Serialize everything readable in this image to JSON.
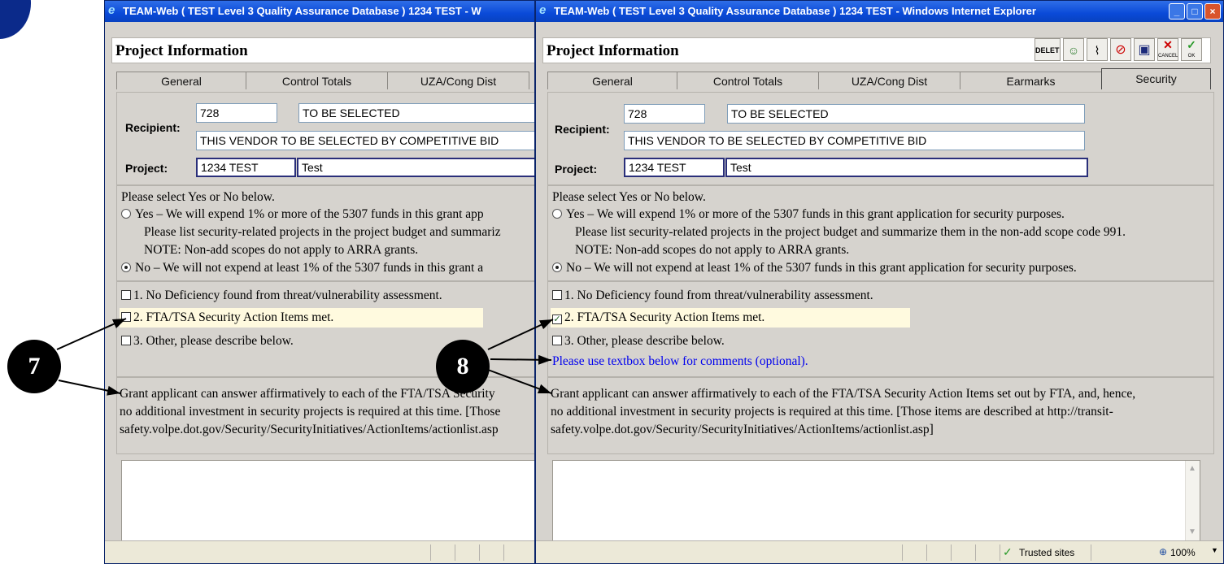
{
  "left_window": {
    "title": "TEAM-Web ( TEST Level 3 Quality Assurance Database ) 1234 TEST - W",
    "header_title": "Project Information",
    "tabs": [
      "General",
      "Control Totals",
      "UZA/Cong Dist"
    ],
    "recipient_label": "Recipient:",
    "recipient_id": "728",
    "recipient_short": "TO BE SELECTED",
    "recipient_full": "THIS VENDOR TO BE SELECTED BY COMPETITIVE BID",
    "project_label": "Project:",
    "project_id": "1234 TEST",
    "project_name": "Test",
    "prompt": "Please select Yes or No below.",
    "yes_option": "Yes – We will expend 1% or more of the 5307 funds in this grant app",
    "yes_note1": "Please list security-related projects in the project budget and summariz",
    "yes_note2": "NOTE: Non-add scopes do not apply to ARRA grants.",
    "no_option": "No – We will not expend at least 1% of the 5307 funds in this grant a",
    "checkbox1": "1. No Deficiency found from threat/vulnerability assessment.",
    "checkbox2": "2. FTA/TSA Security Action Items met.",
    "checkbox3": "3. Other, please describe below.",
    "grant_text1": "Grant applicant can answer affirmatively to each of the FTA/TSA Security",
    "grant_text2": "no additional investment in security projects is required at this time. [Those",
    "grant_text3": "safety.volpe.dot.gov/Security/SecurityInitiatives/ActionItems/actionlist.asp"
  },
  "right_window": {
    "title": "TEAM-Web ( TEST Level 3 Quality Assurance Database ) 1234 TEST - Windows Internet Explorer",
    "header_title": "Project Information",
    "toolbar": {
      "delete_label": "DELETE",
      "cancel_label": "CANCEL",
      "ok_label": "OK"
    },
    "tabs": [
      "General",
      "Control Totals",
      "UZA/Cong Dist",
      "Earmarks",
      "Security"
    ],
    "active_tab": "Security",
    "recipient_label": "Recipient:",
    "recipient_id": "728",
    "recipient_short": "TO BE SELECTED",
    "recipient_full": "THIS VENDOR TO BE SELECTED BY COMPETITIVE BID",
    "project_label": "Project:",
    "project_id": "1234 TEST",
    "project_name": "Test",
    "prompt": "Please select Yes or No below.",
    "yes_option": "Yes – We will expend 1% or more of the 5307 funds in this grant application for security purposes.",
    "yes_note1": "Please list security-related projects in the project budget and summarize them in the non-add scope code 991.",
    "yes_note2": "NOTE: Non-add scopes do not apply to ARRA grants.",
    "no_option": "No  – We will not expend at least 1% of the 5307 funds in this grant application for security purposes.",
    "checkbox1": "1. No Deficiency found from threat/vulnerability assessment.",
    "checkbox2": "2. FTA/TSA Security Action Items met.",
    "checkbox3": "3. Other, please describe below.",
    "comment_hint": "Please use textbox below for comments (optional).",
    "grant_text1": "Grant applicant can answer affirmatively to each of the FTA/TSA Security Action Items set out by FTA, and, hence,",
    "grant_text2": "no additional investment in security projects is required at this time. [Those items are described at http://transit-",
    "grant_text3": "safety.volpe.dot.gov/Security/SecurityInitiatives/ActionItems/actionlist.asp]",
    "status_zone": "Trusted sites",
    "zoom": "100%"
  },
  "callouts": {
    "left": "7",
    "right": "8"
  }
}
